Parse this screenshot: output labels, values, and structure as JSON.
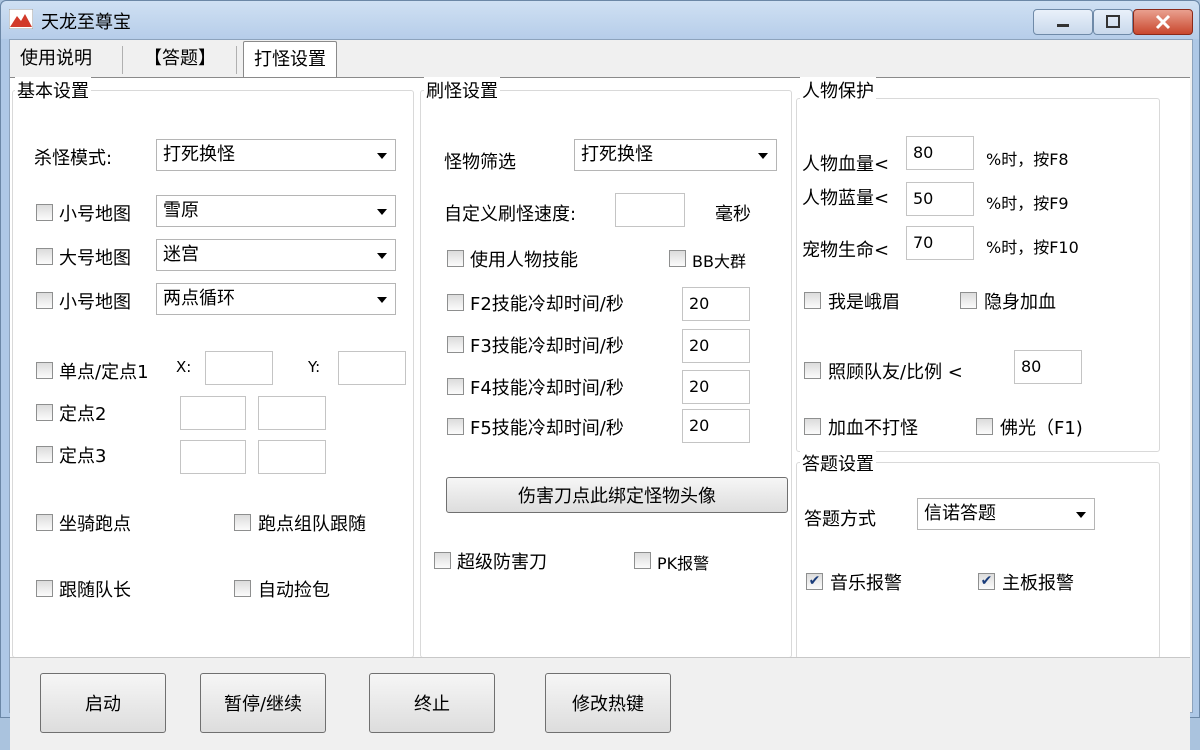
{
  "window": {
    "title": "天龙至尊宝",
    "colors": {
      "accent": "#c9472e",
      "frame": "#aec8e6"
    }
  },
  "tabs": [
    {
      "label": "使用说明"
    },
    {
      "label": "【答题】"
    },
    {
      "label": "打怪设置"
    }
  ],
  "basic": {
    "title": "基本设置",
    "kill_mode_label": "杀怪模式:",
    "kill_mode_value": "打死换怪",
    "maps": [
      {
        "label": "小号地图",
        "value": "雪原",
        "checked": false
      },
      {
        "label": "大号地图",
        "value": "迷宫",
        "checked": false
      },
      {
        "label": "小号地图",
        "value": "两点循环",
        "checked": false
      }
    ],
    "point1_label": "单点/定点1",
    "x_label": "X:",
    "y_label": "Y:",
    "point2_label": "定点2",
    "point3_label": "定点3",
    "mount_run": "坐骑跑点",
    "team_follow_run": "跑点组队跟随",
    "follow_leader": "跟随队长",
    "auto_loot": "自动捡包"
  },
  "brush": {
    "title": "刷怪设置",
    "filter_label": "怪物筛选",
    "filter_value": "打死换怪",
    "speed_label": "自定义刷怪速度:",
    "speed_value": "",
    "speed_unit": "毫秒",
    "use_skill": "使用人物技能",
    "bb_group": "BB大群",
    "skills": [
      {
        "label": "F2技能冷却时间/秒",
        "value": "20"
      },
      {
        "label": "F3技能冷却时间/秒",
        "value": "20"
      },
      {
        "label": "F4技能冷却时间/秒",
        "value": "20"
      },
      {
        "label": "F5技能冷却时间/秒",
        "value": "20"
      }
    ],
    "bind_button": "伤害刀点此绑定怪物头像",
    "super_blade": "超级防害刀",
    "pk_alarm": "PK报警"
  },
  "protect": {
    "title": "人物保护",
    "hp_label": "人物血量<",
    "hp_value": "80",
    "hp_suffix": "%时，按F8",
    "mp_label": "人物蓝量<",
    "mp_value": "50",
    "mp_suffix": "%时，按F9",
    "pet_label": "宠物生命<",
    "pet_value": "70",
    "pet_suffix": "%时，按F10",
    "emei": "我是峨眉",
    "stealth_heal": "隐身加血",
    "care_team": "照顾队友/比例 <",
    "care_value": "80",
    "heal_no_fight": "加血不打怪",
    "buddha_light": "佛光（F1)"
  },
  "answer": {
    "title": "答题设置",
    "mode_label": "答题方式",
    "mode_value": "信诺答题",
    "music_alarm": "音乐报警",
    "music_checked": true,
    "board_alarm": "主板报警",
    "board_checked": true
  },
  "buttons": {
    "start": "启动",
    "pause": "暂停/继续",
    "stop": "终止",
    "hotkey": "修改热键"
  }
}
